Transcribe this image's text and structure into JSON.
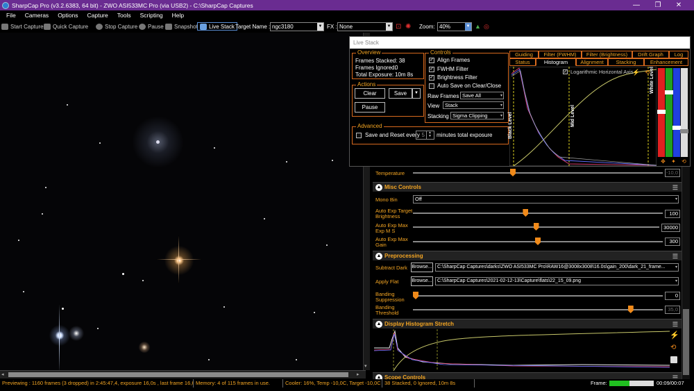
{
  "window": {
    "title": "SharpCap Pro (v3.2.6383, 64 bit) - ZWO ASI533MC Pro (via USB2) - C:\\SharpCap Captures",
    "min": "—",
    "max": "❐",
    "close": "✕"
  },
  "menu": [
    "File",
    "Cameras",
    "Options",
    "Capture",
    "Tools",
    "Scripting",
    "Help"
  ],
  "toolbar": {
    "start_capture": "Start Capture",
    "quick_capture": "Quick Capture",
    "stop_capture": "Stop Capture",
    "pause": "Pause",
    "snapshot": "Snapshot",
    "live_stack": "Live Stack",
    "target_label": "Target Name :",
    "target_value": "ngc3180",
    "fx_label": "FX :",
    "fx_value": "None",
    "zoom_label": "Zoom:",
    "zoom_value": "40%"
  },
  "livestack": {
    "title": "Live Stack",
    "overview": {
      "title": "Overview",
      "frames_stacked": "Frames Stacked: 38",
      "frames_ignored": "Frames Ignored:",
      "frames_ignored_value": "0",
      "total_exposure": "Total Exposure:",
      "total_exposure_value": "10m 8s"
    },
    "actions": {
      "title": "Actions",
      "clear": "Clear",
      "save": "Save",
      "pause": "Pause"
    },
    "advanced": {
      "title": "Advanced",
      "save_reset": "Save and Reset every",
      "minutes_value": "5",
      "minutes_label": "minutes total exposure"
    },
    "controls": {
      "title": "Controls",
      "align": "Align Frames",
      "fwhm": "FWHM Filter",
      "brightness": "Brightness Filter",
      "autosave": "Auto Save on Clear/Close",
      "raw_frames_label": "Raw Frames",
      "raw_frames_value": "Save All",
      "view_label": "View",
      "view_value": "Stack",
      "stacking_label": "Stacking",
      "stacking_value": "Sigma Clipping"
    },
    "tabs_row1": [
      "Guiding",
      "Filter (FWHM)",
      "Filter (Brightness)",
      "Drift Graph",
      "Log"
    ],
    "tabs_row2": [
      "Status",
      "Histogram",
      "Alignment",
      "Stacking",
      "Enhancement"
    ],
    "histogram": {
      "log_axis": "Logarithmic Horizontal Axis",
      "black": "Black Level",
      "mid": "Mid Level",
      "white": "White Level"
    }
  },
  "camera_controls": {
    "temperature_label": "Temperature",
    "temperature_value": "-10,0",
    "misc_header": "Misc Controls",
    "mono_bin_label": "Mono Bin",
    "mono_bin_value": "Off",
    "auto_exp_target_label": "Auto Exp Target Brightness",
    "auto_exp_target_value": "100",
    "auto_exp_target_level": 0.45,
    "auto_exp_max_ms_label": "Auto Exp Max Exp M S",
    "auto_exp_max_ms_value": "30000",
    "auto_exp_max_ms_level": 0.5,
    "auto_exp_max_gain_label": "Auto Exp Max Gain",
    "auto_exp_max_gain_value": "300",
    "auto_exp_max_gain_level": 0.5,
    "pre_header": "Preprocessing",
    "subtract_dark_label": "Subtract Dark",
    "browse": "Browse...",
    "subtract_dark_path": "C:\\SharpCap Captures\\darks\\ZWO ASI533MC Pro\\RAW16@3008x3008\\16.0s\\gain_200\\dark_21_frame...",
    "apply_flat_label": "Apply Flat",
    "apply_flat_path": "C:\\SharpCap Captures\\2021-02-12-13\\Capture\\flats\\22_15_09.png",
    "banding_supp_label": "Banding Suppression",
    "banding_supp_value": "0",
    "banding_supp_level": 0.0,
    "banding_thr_label": "Banding Threshold",
    "banding_thr_value": "35,0",
    "banding_thr_level": 0.88,
    "hist_header": "Display Histogram Stretch",
    "scope_header": "Scope Controls"
  },
  "status": {
    "preview": "Previewing : 1160 frames (3 dropped) in 2:45:47,4, exposure 16,0s , last frame 16,6",
    "memory": "Memory: 4 of 115 frames in use.",
    "cooler": "Cooler: 16%, Temp -10,0C, Target -10,0C",
    "stacked": "38 Stacked, 0 Ignored, 10m 8s",
    "frame_label": "Frame:",
    "frame_progress": 0.45,
    "time": "00:09/00:07"
  },
  "colors": {
    "accent": "#f5a623",
    "title": "#6a2c91",
    "border": "#d86a1e"
  }
}
